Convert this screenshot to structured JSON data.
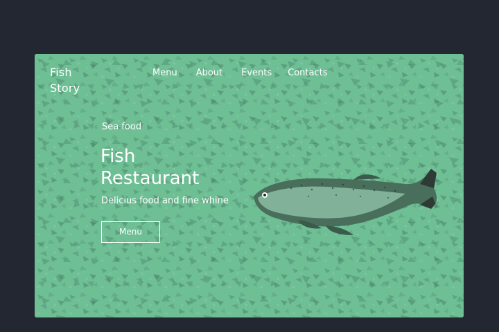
{
  "brand": {
    "logo_line1": "Fish",
    "logo_line2": "Story"
  },
  "nav": {
    "items": [
      {
        "label": "Menu"
      },
      {
        "label": "About"
      },
      {
        "label": "Events"
      },
      {
        "label": "Contacts"
      }
    ]
  },
  "hero": {
    "eyebrow": "Sea food",
    "title_line1": "Fish",
    "title_line2": "Restaurant",
    "subtitle": "Delicius food and fine whine",
    "cta_label": "Menu"
  },
  "colors": {
    "page_background": "#222731",
    "card_tint": "#6fbf95",
    "text": "#ffffff"
  },
  "icons": {
    "hero_image": "fish-image"
  }
}
